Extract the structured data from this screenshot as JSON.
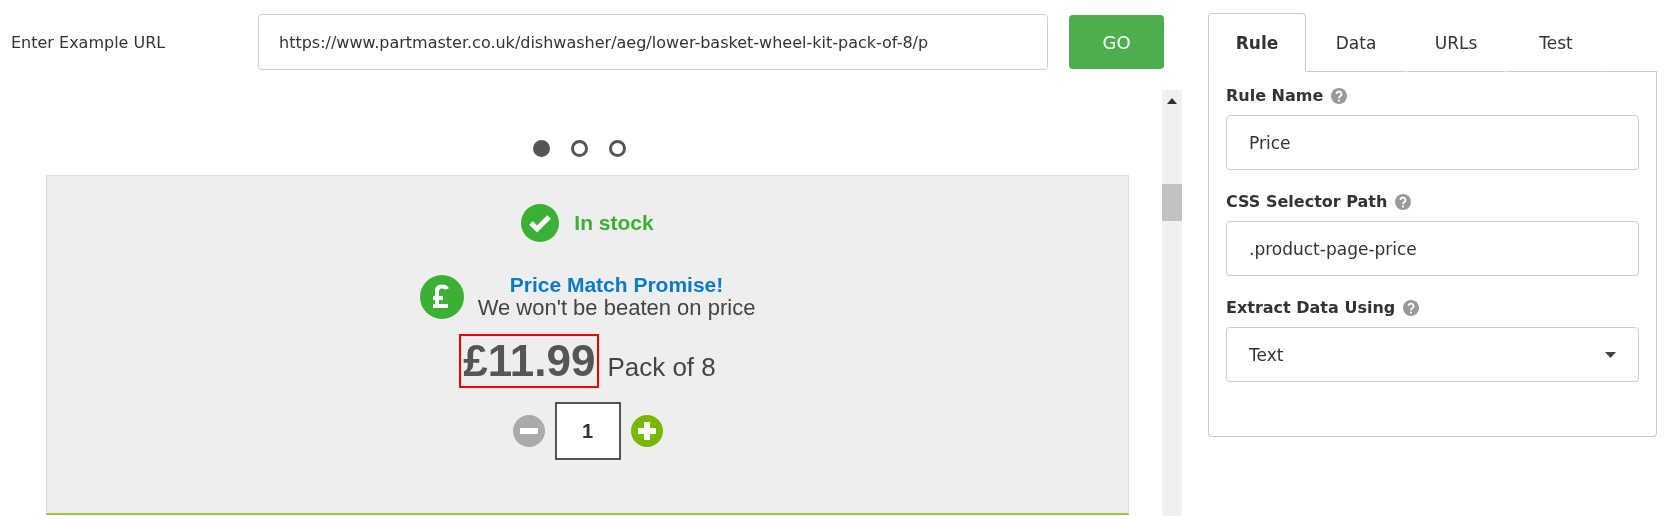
{
  "url_bar": {
    "label": "Enter Example URL",
    "value": "https://www.partmaster.co.uk/dishwasher/aeg/lower-basket-wheel-kit-pack-of-8/p",
    "button": "GO"
  },
  "preview": {
    "carousel_dots": [
      {
        "selected": true
      },
      {
        "selected": false
      },
      {
        "selected": false
      }
    ],
    "stock": "In stock",
    "promise_title": "Price Match Promise!",
    "promise_text": "We won't be beaten on price",
    "price": "£11.99",
    "price_highlighted": true,
    "pack": "Pack of 8",
    "quantity": "1"
  },
  "tabs": [
    {
      "label": "Rule",
      "selected": true
    },
    {
      "label": "Data",
      "selected": false
    },
    {
      "label": "URLs",
      "selected": false
    },
    {
      "label": "Test",
      "selected": false
    }
  ],
  "form": [
    {
      "kind": "text",
      "label": "Rule Name",
      "value": "Price"
    },
    {
      "kind": "text",
      "label": "CSS Selector Path",
      "value": ".product-page-price"
    },
    {
      "kind": "select",
      "label": "Extract Data Using",
      "value": "Text"
    }
  ]
}
